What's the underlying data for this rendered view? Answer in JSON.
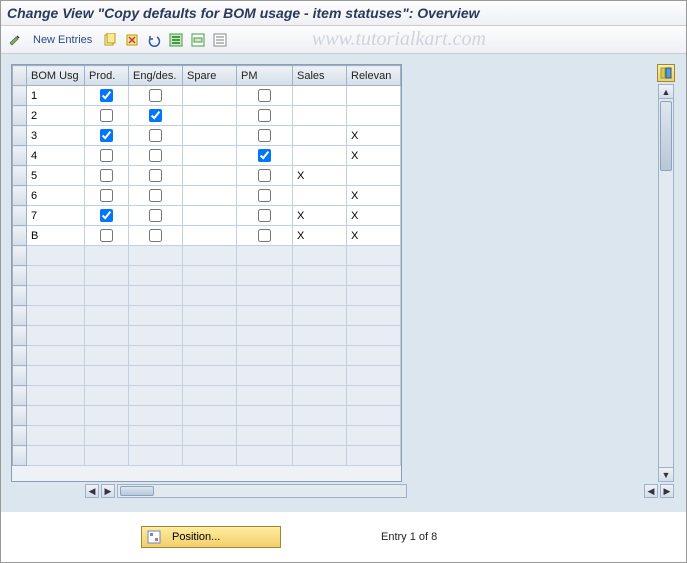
{
  "title": "Change View \"Copy defaults for BOM usage - item statuses\": Overview",
  "watermark": "www.tutorialkart.com",
  "toolbar": {
    "new_entries": "New Entries"
  },
  "footer": {
    "position_label": "Position...",
    "entry_text": "Entry 1 of 8"
  },
  "columns": {
    "bom_usg": "BOM Usg",
    "prod": "Prod.",
    "eng": "Eng/des.",
    "spare": "Spare",
    "pm": "PM",
    "sales": "Sales",
    "relevan": "Relevan"
  },
  "rows": [
    {
      "usg": "1",
      "prod": true,
      "eng": false,
      "spare": "",
      "pm": false,
      "sales": "",
      "rel": ""
    },
    {
      "usg": "2",
      "prod": false,
      "eng": true,
      "spare": "",
      "pm": false,
      "sales": "",
      "rel": ""
    },
    {
      "usg": "3",
      "prod": true,
      "eng": false,
      "spare": "",
      "pm": false,
      "sales": "",
      "rel": "X"
    },
    {
      "usg": "4",
      "prod": false,
      "eng": false,
      "spare": "",
      "pm": true,
      "sales": "",
      "rel": "X"
    },
    {
      "usg": "5",
      "prod": false,
      "eng": false,
      "spare": "",
      "pm": false,
      "sales": "X",
      "rel": ""
    },
    {
      "usg": "6",
      "prod": false,
      "eng": false,
      "spare": "",
      "pm": false,
      "sales": "",
      "rel": "X"
    },
    {
      "usg": "7",
      "prod": true,
      "eng": false,
      "spare": "",
      "pm": false,
      "sales": "X",
      "rel": "X"
    },
    {
      "usg": "B",
      "prod": false,
      "eng": false,
      "spare": "",
      "pm": false,
      "sales": "X",
      "rel": "X"
    }
  ],
  "empty_rows": 11
}
